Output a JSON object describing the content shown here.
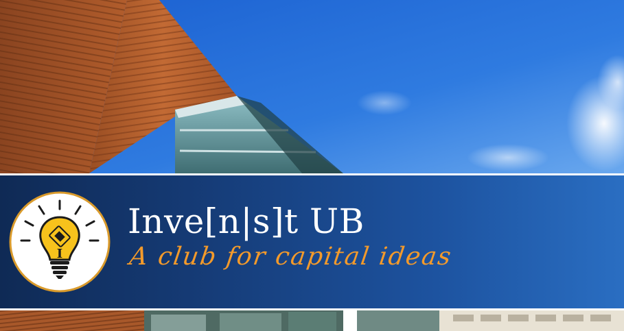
{
  "header": {
    "title": "Inve[n|s]t UB",
    "tagline": "A club for capital ideas"
  },
  "logo": {
    "icon": "lightbulb-icon",
    "emblem_letter": "I"
  },
  "colors": {
    "banner_dark": "#0f2a55",
    "banner_light": "#2a6ec2",
    "accent_orange": "#f39a2b",
    "bulb_yellow": "#f7c21c",
    "sky_blue": "#1f66c9"
  }
}
